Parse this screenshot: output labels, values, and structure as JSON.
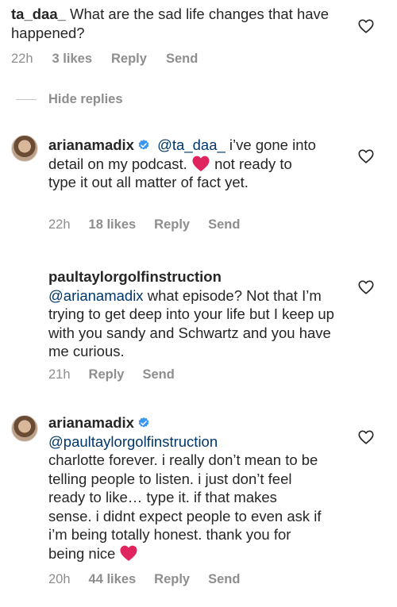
{
  "comments": [
    {
      "username": "ta_daa_",
      "text": "What are the sad life changes that have happened?",
      "time": "22h",
      "likes": "3 likes",
      "reply": "Reply",
      "send": "Send"
    },
    {
      "username": "arianamadix",
      "mention": "@ta_daa_",
      "text_part1": "i’ve gone into detail on my podcast.",
      "text_part2": "not ready to type it out all matter of fact yet.",
      "time": "22h",
      "likes": "18 likes",
      "reply": "Reply",
      "send": "Send"
    },
    {
      "username": "paultaylorgolfinstruction",
      "mention": "@arianamadix",
      "text": "what episode? Not that I’m trying to get deep into your life but I keep up with you sandy and Schwartz and you have me curious.",
      "time": "21h",
      "reply": "Reply",
      "send": "Send"
    },
    {
      "username": "arianamadix",
      "mention": "@paultaylorgolfinstruction",
      "text": "charlotte forever. i really don’t mean to be telling people to listen. i just don’t feel ready to like… type it. if that makes sense. i didnt expect people to even ask if i’m being totally honest. thank you for being nice",
      "time": "20h",
      "likes": "44 likes",
      "reply": "Reply",
      "send": "Send"
    }
  ],
  "hide_replies": "Hide replies",
  "colors": {
    "text": "#262626",
    "meta": "#8e8e8e",
    "mention": "#00376b",
    "verified": "#3897f0",
    "heart_emoji": "#e0245e"
  }
}
